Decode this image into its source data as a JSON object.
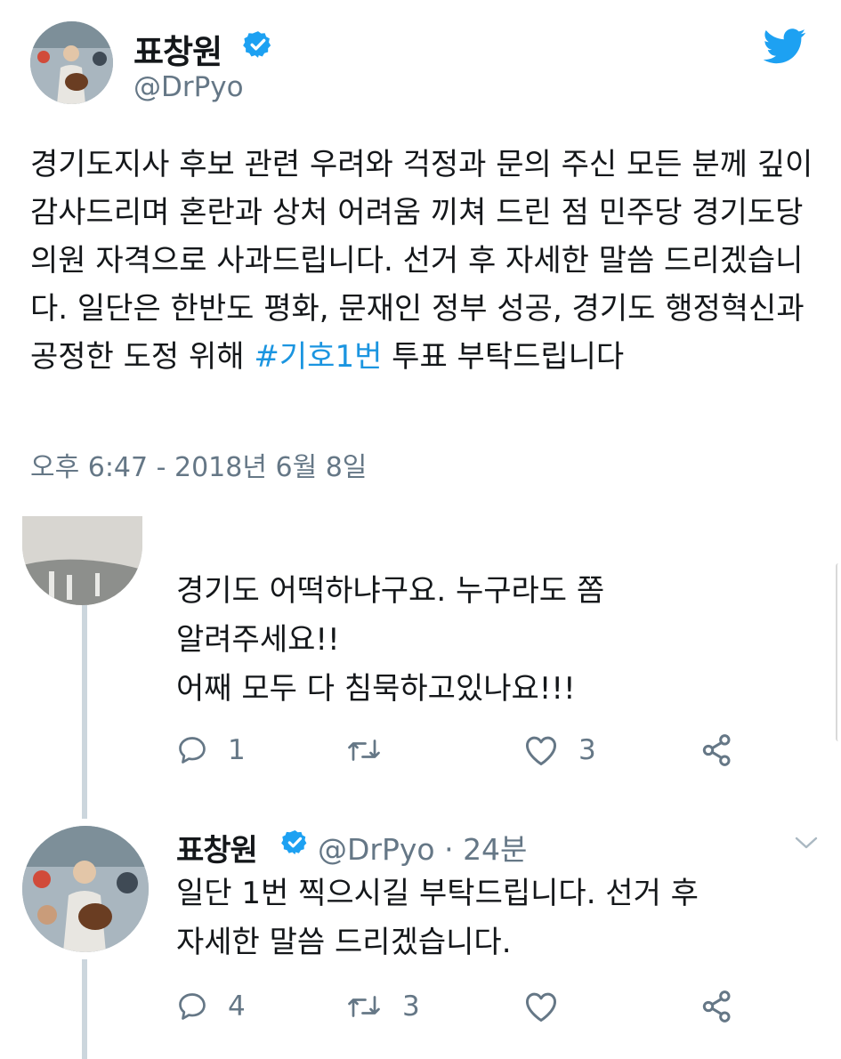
{
  "tweet": {
    "author_name": "표창원",
    "author_handle": "@DrPyo",
    "text_before_hashtag": "경기도지사 후보 관련 우려와 걱정과 문의 주신 모든 분께 깊이 감사드리며 혼란과 상처 어려움 끼쳐 드린 점 민주당 경기도당 의원 자격으로 사과드립니다. 선거 후 자세한 말씀 드리겠습니다. 일단은 한반도 평화, 문재인 정부 성공, 경기도 행정혁신과 공정한 도정 위해 ",
    "hashtag": "#기호1번",
    "text_after_hashtag": " 투표 부탁드립니다",
    "timestamp": "오후 6:47 - 2018년 6월 8일"
  },
  "replies": [
    {
      "lines": [
        "경기도 어떡하냐구요.  누구라도 쫌",
        "알려주세요!!",
        "어째 모두 다 침묵하고있나요!!!"
      ],
      "reply_count": "1",
      "retweet_count": "",
      "like_count": "3"
    },
    {
      "author_name": "표창원",
      "meta": "@DrPyo · 24분",
      "lines": [
        "일단 1번 찍으시길 부탁드립니다. 선거 후",
        "자세한 말씀 드리겠습니다."
      ],
      "reply_count": "4",
      "retweet_count": "3",
      "like_count": ""
    }
  ],
  "icons": {
    "brand": "twitter-bird-icon",
    "verified": "verified-badge-icon",
    "reply": "reply-icon",
    "retweet": "retweet-icon",
    "like": "heart-icon",
    "share": "share-icon",
    "menu": "chevron-down-icon"
  },
  "colors": {
    "text": "#14171a",
    "secondary": "#657786",
    "link": "#1b95e0",
    "brand_blue": "#1da1f2",
    "thread_line": "#ccd6dd"
  }
}
